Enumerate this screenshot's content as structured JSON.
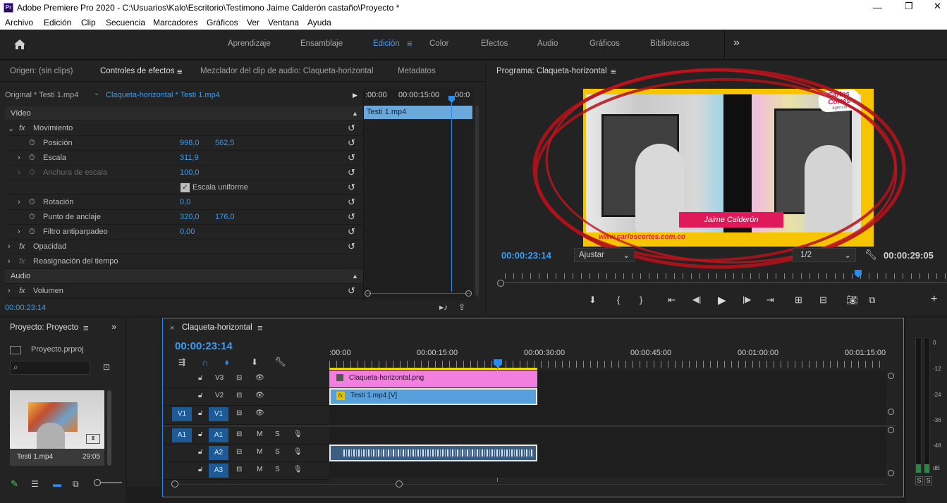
{
  "title_bar": {
    "app_icon": "Pr",
    "title": "Adobe Premiere Pro 2020 - C:\\Usuarios\\Kalo\\Escritorio\\Testimono Jaime Calderón castaño\\Proyecto *"
  },
  "menu": [
    "Archivo",
    "Edición",
    "Clip",
    "Secuencia",
    "Marcadores",
    "Gráficos",
    "Ver",
    "Ventana",
    "Ayuda"
  ],
  "workspaces": {
    "items": [
      "Aprendizaje",
      "Ensamblaje",
      "Edición",
      "Color",
      "Efectos",
      "Audio",
      "Gráficos",
      "Bibliotecas"
    ],
    "active": "Edición",
    "more": "»"
  },
  "source_panel": {
    "tabs": [
      "Origen: (sin clips)",
      "Controles de efectos",
      "Mezclador del clip de audio: Claqueta-horizontal",
      "Metadatos"
    ],
    "active_tab": "Controles de efectos",
    "master_clip": "Original * Testi 1.mp4",
    "sequence_clip": "Claqueta-horizontal * Testi 1.mp4",
    "ruler_times": [
      ":00:00",
      "00:00:15:00",
      "00:0"
    ],
    "mini_clip_label": "Testi 1.mp4",
    "section_video": "Vídeo",
    "section_audio": "Audio",
    "fx_label": "fx",
    "rows": {
      "movimiento": "Movimiento",
      "posicion": "Posición",
      "posicion_x": "998,0",
      "posicion_y": "562,5",
      "escala": "Escala",
      "escala_val": "311,9",
      "anchura": "Anchura de escala",
      "anchura_val": "100,0",
      "escala_uniforme": "Escala uniforme",
      "rotacion": "Rotación",
      "rotacion_val": "0,0",
      "punto_anclaje": "Punto de anclaje",
      "anclaje_x": "320,0",
      "anclaje_y": "176,0",
      "filtro": "Filtro antiparpadeo",
      "filtro_val": "0,00",
      "opacidad": "Opacidad",
      "reasignacion": "Reasignación del tiempo",
      "volumen": "Volumen"
    },
    "timecode": "00:00:23:14"
  },
  "program_panel": {
    "title": "Programa: Claqueta-horizontal",
    "timecode": "00:00:23:14",
    "fit": "Ajustar",
    "resolution": "1/2",
    "duration": "00:00:29:05",
    "video": {
      "brand_line1": "Carlos",
      "brand_line2": "Cortés",
      "brand_sub": "agencia",
      "name_banner": "Jaime Calderón",
      "website": "www.carloscortes.com.co",
      "frame_color": "#f7c400",
      "banner_color": "#e01a5a",
      "annotation_color": "#b3121a"
    }
  },
  "project_panel": {
    "title": "Proyecto: Proyecto",
    "file": "Proyecto.prproj",
    "clip_name": "Testi 1.mp4",
    "clip_duration": "29:05"
  },
  "timeline": {
    "sequence": "Claqueta-horizontal",
    "timecode": "00:00:23:14",
    "ruler": [
      ":00:00",
      "00:00:15:00",
      "00:00:30:00",
      "00:00:45:00",
      "00:01:00:00",
      "00:01:15:00"
    ],
    "tracks": {
      "v3": "V3",
      "v2": "V2",
      "v1": "V1",
      "a1": "A1",
      "a2": "A2",
      "a3": "A3",
      "src_v1": "V1",
      "src_a1": "A1",
      "m": "M",
      "s": "S"
    },
    "clips": {
      "v3": "Claqueta-horizontal.png",
      "v2": "Testi 1.mp4 [V]",
      "fx": "fx"
    },
    "playhead_fraction": 0.787
  },
  "audio_meter": {
    "scale": [
      "0",
      "-12",
      "-24",
      "-36",
      "-48",
      "dB"
    ],
    "solo": [
      "S",
      "S"
    ]
  },
  "colors": {
    "accent": "#2d8ceb",
    "timeline_blue": "#1e5a95",
    "clip_pink": "#f27ee0",
    "clip_blue": "#58a0dc"
  }
}
